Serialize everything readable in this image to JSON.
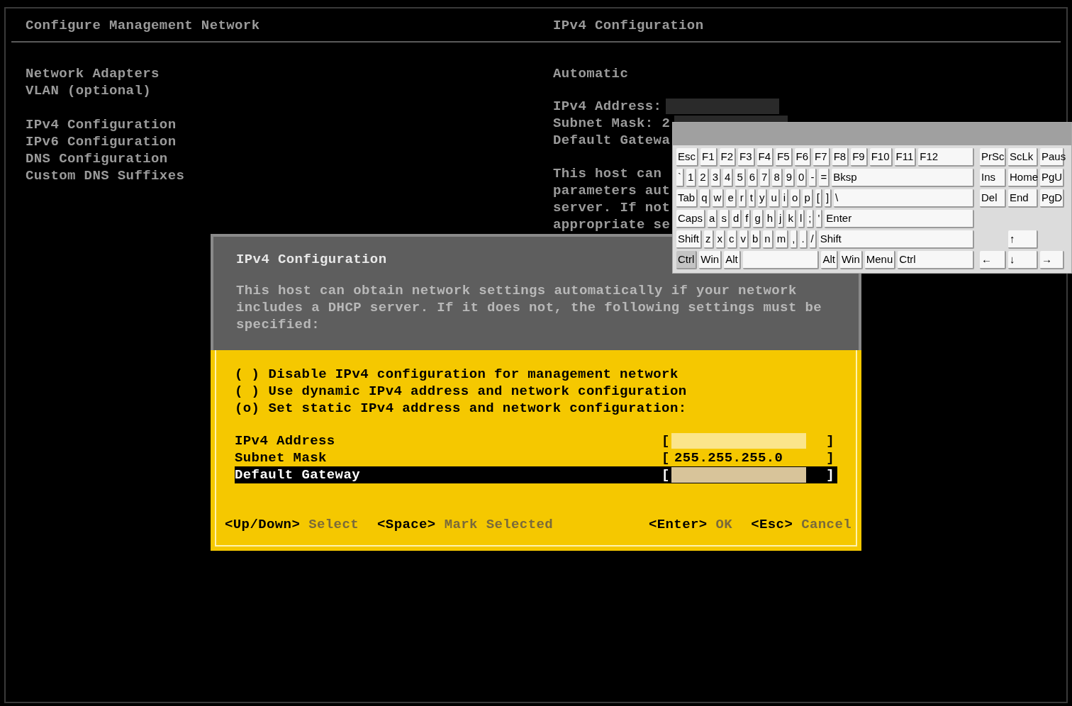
{
  "screen": {
    "title": "Configure Management Network",
    "right_title": "IPv4 Configuration"
  },
  "menu": {
    "groups": [
      [
        "Network Adapters",
        "VLAN (optional)"
      ],
      [
        "IPv4 Configuration",
        "IPv6 Configuration",
        "DNS Configuration",
        "Custom DNS Suffixes"
      ]
    ]
  },
  "details": {
    "mode": "Automatic",
    "fields": [
      {
        "label": "IPv4 Address:",
        "redacted": true
      },
      {
        "label": "Subnet Mask: 2",
        "redacted": true
      },
      {
        "label": "Default Gatewa",
        "redacted": false
      }
    ],
    "description": [
      "This host can",
      "parameters aut",
      "server. If not",
      "appropriate se"
    ]
  },
  "dialog": {
    "title": "IPv4 Configuration",
    "description": "This host can obtain network settings automatically if your network includes a DHCP server. If it does not, the following settings must be specified:",
    "options": [
      {
        "marker": "( )",
        "label": "Disable IPv4 configuration for management network"
      },
      {
        "marker": "( )",
        "label": "Use dynamic IPv4 address and network configuration"
      },
      {
        "marker": "(o)",
        "label": "Set static IPv4 address and network configuration:"
      }
    ],
    "brackets": {
      "open": "[",
      "close": "]"
    },
    "fields": [
      {
        "label": "IPv4 Address",
        "redacted": true,
        "selected": false
      },
      {
        "label": "Subnet Mask",
        "value": "255.255.255.0",
        "redacted": false,
        "selected": false
      },
      {
        "label": "Default Gateway",
        "redacted": true,
        "selected": true
      }
    ],
    "hints_left": [
      {
        "key": "<Up/Down>",
        "action": "Select"
      },
      {
        "key": "<Space>",
        "action": "Mark Selected"
      }
    ],
    "hints_right": [
      {
        "key": "<Enter>",
        "action": "OK"
      },
      {
        "key": "<Esc>",
        "action": "Cancel"
      }
    ]
  },
  "keyboard": {
    "main_rows": [
      [
        {
          "label": "Esc",
          "pressed": false
        },
        {
          "label": "F1",
          "pressed": false
        },
        {
          "label": "F2",
          "pressed": false
        },
        {
          "label": "F3",
          "pressed": false
        },
        {
          "label": "F4",
          "pressed": false
        },
        {
          "label": "F5",
          "pressed": false
        },
        {
          "label": "F6",
          "pressed": false
        },
        {
          "label": "F7",
          "pressed": false
        },
        {
          "label": "F8",
          "pressed": false
        },
        {
          "label": "F9",
          "pressed": false
        },
        {
          "label": "F10",
          "pressed": false
        },
        {
          "label": "F11",
          "pressed": false
        },
        {
          "label": "F12",
          "pressed": false
        }
      ],
      [
        {
          "label": "`",
          "pressed": false
        },
        {
          "label": "1",
          "pressed": false
        },
        {
          "label": "2",
          "pressed": false
        },
        {
          "label": "3",
          "pressed": false
        },
        {
          "label": "4",
          "pressed": false
        },
        {
          "label": "5",
          "pressed": false
        },
        {
          "label": "6",
          "pressed": false
        },
        {
          "label": "7",
          "pressed": false
        },
        {
          "label": "8",
          "pressed": false
        },
        {
          "label": "9",
          "pressed": false
        },
        {
          "label": "0",
          "pressed": false
        },
        {
          "label": "-",
          "pressed": false
        },
        {
          "label": "=",
          "pressed": false
        },
        {
          "label": "Bksp",
          "pressed": false
        }
      ],
      [
        {
          "label": "Tab",
          "pressed": false
        },
        {
          "label": "q",
          "pressed": false
        },
        {
          "label": "w",
          "pressed": false
        },
        {
          "label": "e",
          "pressed": false
        },
        {
          "label": "r",
          "pressed": false
        },
        {
          "label": "t",
          "pressed": false
        },
        {
          "label": "y",
          "pressed": false
        },
        {
          "label": "u",
          "pressed": false
        },
        {
          "label": "i",
          "pressed": false
        },
        {
          "label": "o",
          "pressed": false
        },
        {
          "label": "p",
          "pressed": false
        },
        {
          "label": "[",
          "pressed": false
        },
        {
          "label": "]",
          "pressed": false
        },
        {
          "label": "\\",
          "pressed": false
        }
      ],
      [
        {
          "label": "Caps",
          "pressed": false
        },
        {
          "label": "a",
          "pressed": false
        },
        {
          "label": "s",
          "pressed": false
        },
        {
          "label": "d",
          "pressed": false
        },
        {
          "label": "f",
          "pressed": false
        },
        {
          "label": "g",
          "pressed": false
        },
        {
          "label": "h",
          "pressed": false
        },
        {
          "label": "j",
          "pressed": false
        },
        {
          "label": "k",
          "pressed": false
        },
        {
          "label": "l",
          "pressed": false
        },
        {
          "label": ";",
          "pressed": false
        },
        {
          "label": "'",
          "pressed": false
        },
        {
          "label": "Enter",
          "pressed": false
        }
      ],
      [
        {
          "label": "Shift",
          "pressed": false
        },
        {
          "label": "z",
          "pressed": false
        },
        {
          "label": "x",
          "pressed": false
        },
        {
          "label": "c",
          "pressed": false
        },
        {
          "label": "v",
          "pressed": false
        },
        {
          "label": "b",
          "pressed": false
        },
        {
          "label": "n",
          "pressed": false
        },
        {
          "label": "m",
          "pressed": false
        },
        {
          "label": ",",
          "pressed": false
        },
        {
          "label": ".",
          "pressed": false
        },
        {
          "label": "/",
          "pressed": false
        },
        {
          "label": "Shift",
          "pressed": false
        }
      ],
      [
        {
          "label": "Ctrl",
          "pressed": true
        },
        {
          "label": "Win",
          "pressed": false
        },
        {
          "label": "Alt",
          "pressed": false
        },
        {
          "kind": "space",
          "pressed": false
        },
        {
          "label": "Alt",
          "pressed": false
        },
        {
          "label": "Win",
          "pressed": false
        },
        {
          "label": "Menu",
          "pressed": false
        },
        {
          "label": "Ctrl",
          "pressed": false
        }
      ]
    ],
    "nav_rows": [
      [
        {
          "label": "PrSc",
          "pressed": false
        },
        {
          "label": "ScLk",
          "pressed": false
        },
        {
          "label": "Paus",
          "pressed": false
        }
      ],
      [
        {
          "label": "Ins",
          "pressed": false
        },
        {
          "label": "Home",
          "pressed": false
        },
        {
          "label": "PgU",
          "pressed": false
        }
      ],
      [
        {
          "label": "Del",
          "pressed": false
        },
        {
          "label": "End",
          "pressed": false
        },
        {
          "label": "PgD",
          "pressed": false
        }
      ],
      [],
      [
        {
          "kind": "gap"
        },
        {
          "label": "↑",
          "pressed": false
        },
        {
          "kind": "gap"
        }
      ],
      [
        {
          "label": "←",
          "pressed": false
        },
        {
          "label": "↓",
          "pressed": false
        },
        {
          "label": "→",
          "pressed": false
        }
      ]
    ]
  }
}
